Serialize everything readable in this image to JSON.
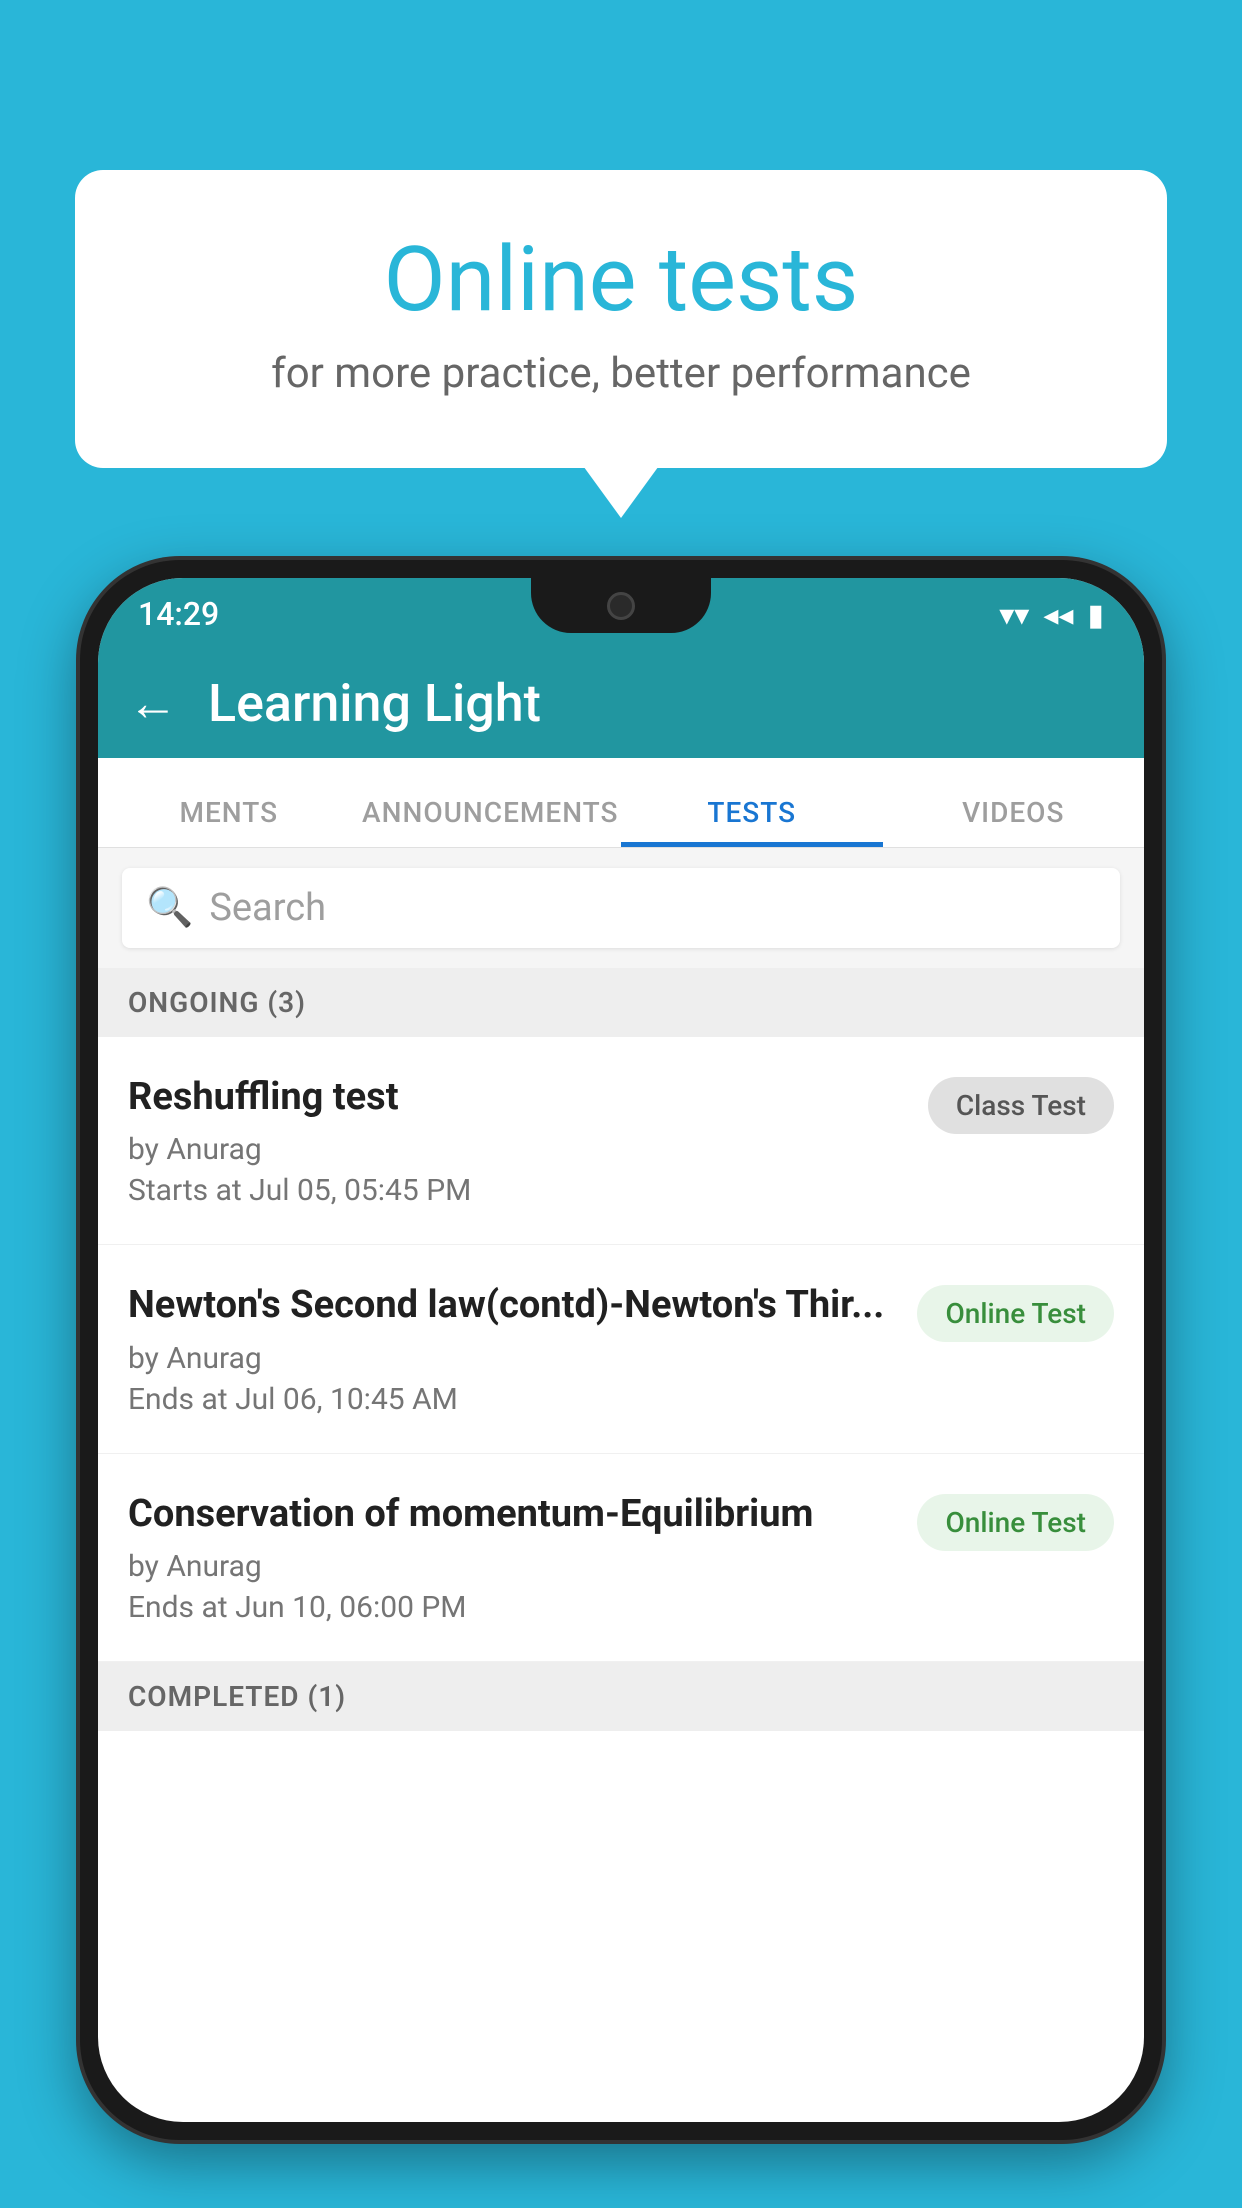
{
  "background_color": "#29b6d8",
  "bubble": {
    "title": "Online tests",
    "subtitle": "for more practice, better performance"
  },
  "status_bar": {
    "time": "14:29",
    "wifi": "▾",
    "signal": "◂",
    "battery": "▮"
  },
  "app_bar": {
    "back_label": "←",
    "title": "Learning Light"
  },
  "tabs": [
    {
      "label": "MENTS",
      "active": false
    },
    {
      "label": "ANNOUNCEMENTS",
      "active": false
    },
    {
      "label": "TESTS",
      "active": true
    },
    {
      "label": "VIDEOS",
      "active": false
    }
  ],
  "search": {
    "placeholder": "Search"
  },
  "ongoing_section": {
    "label": "ONGOING (3)"
  },
  "tests": [
    {
      "title": "Reshuffling test",
      "author": "by Anurag",
      "time_label": "Starts at",
      "time": "Jul 05, 05:45 PM",
      "badge": "Class Test",
      "badge_type": "class"
    },
    {
      "title": "Newton's Second law(contd)-Newton's Thir...",
      "author": "by Anurag",
      "time_label": "Ends at",
      "time": "Jul 06, 10:45 AM",
      "badge": "Online Test",
      "badge_type": "online"
    },
    {
      "title": "Conservation of momentum-Equilibrium",
      "author": "by Anurag",
      "time_label": "Ends at",
      "time": "Jun 10, 06:00 PM",
      "badge": "Online Test",
      "badge_type": "online"
    }
  ],
  "completed_section": {
    "label": "COMPLETED (1)"
  }
}
